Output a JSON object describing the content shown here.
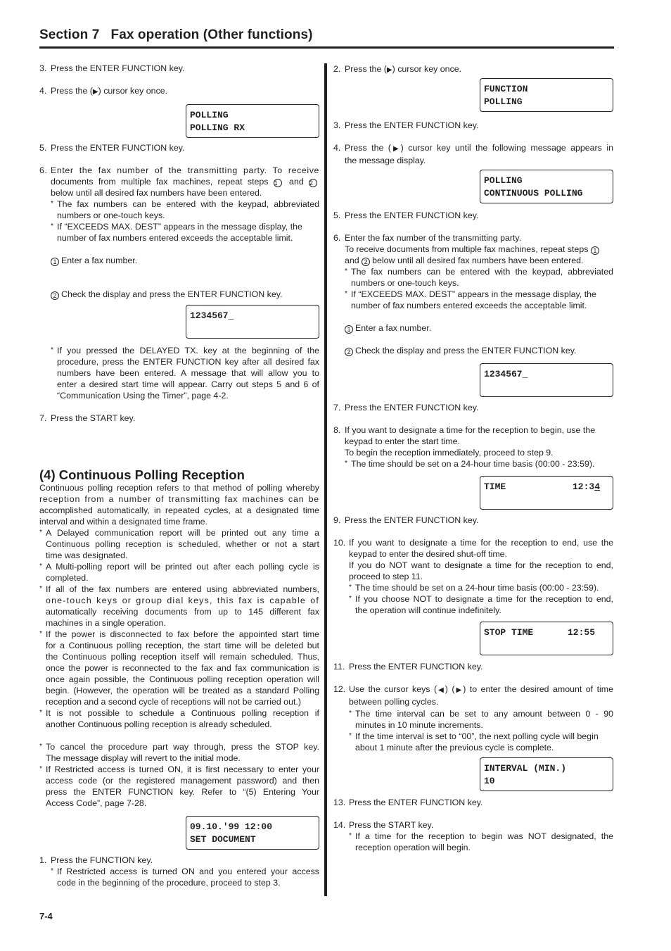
{
  "header": {
    "section": "Section 7",
    "title": "Fax operation (Other functions)"
  },
  "left": {
    "step3": {
      "num": "3.",
      "text": "Press the ENTER FUNCTION key."
    },
    "step4": {
      "num": "4.",
      "pre": "Press the (",
      "arrow": "▶",
      "post": ") cursor key once."
    },
    "lcd1": {
      "line1": "POLLING",
      "line2": "POLLING RX"
    },
    "step5": {
      "num": "5.",
      "text": "Press the ENTER FUNCTION key."
    },
    "step6": {
      "num": "6.",
      "lines": [
        "Enter the fax number of the transmitting party. To receive",
        "documents from multiple fax machines, repeat steps ① and ②",
        "below until all desired fax numbers have been entered."
      ],
      "note1": [
        "The fax numbers can be entered with the keypad, abbreviated",
        "numbers or one-touch keys."
      ],
      "note2": [
        "If “EXCEEDS MAX. DEST” appears in the message display, the",
        "number of fax numbers entered exceeds the acceptable limit."
      ],
      "sub1": {
        "marker": "1",
        "text": "Enter a fax number."
      },
      "sub2": {
        "marker": "2",
        "text": "Check the display and press the ENTER FUNCTION key."
      }
    },
    "lcd2": {
      "line1": "1234567_",
      "line2": ""
    },
    "delayed_note": [
      "If you pressed the DELAYED TX. key at the beginning of the",
      "procedure, press the ENTER FUNCTION key after all desired fax",
      "numbers have been entered. A message that will allow you to",
      "enter a desired start time will appear. Carry out steps 5 and 6 of",
      "“Communication Using the Timer”, page 4-2."
    ],
    "step7": {
      "num": "7.",
      "text": "Press the START key."
    },
    "section_heading": "(4) Continuous Polling Reception",
    "intro": [
      "Continuous polling reception refers to that method of polling whereby",
      "reception from a number of transmitting fax machines can be",
      "accomplished automatically, in repeated cycles, at a designated time",
      "interval and within a designated time frame."
    ],
    "notes": [
      [
        "A Delayed communication report will be printed out any time a",
        "Continuous polling reception is scheduled, whether or not a start",
        "time was designated."
      ],
      [
        "A Multi-polling report will be printed out after each polling cycle is",
        "completed."
      ],
      [
        "If all of the fax numbers are entered using abbreviated numbers,",
        "one-touch keys or group dial keys, this fax is capable of",
        "automatically receiving documents from up to 145 different fax",
        "machines in a single operation."
      ],
      [
        "If the power is disconnected to fax before the appointed start time",
        "for a Continuous polling reception, the start time will be deleted but",
        "the Continuous polling reception itself will remain scheduled. Thus,",
        "once the power is reconnected to the fax and fax communication is",
        "once again possible, the Continuous polling reception operation will",
        "begin. (However, the operation will be treated as a standard Polling",
        "reception and a second cycle of receptions will not be carried out.)"
      ],
      [
        "It is not possible to schedule a Continuous polling reception if",
        "another Continuous polling reception is already scheduled."
      ]
    ],
    "notes2": [
      [
        "To cancel the procedure part way through, press the STOP key.",
        "The message display will revert to the initial mode."
      ],
      [
        "If Restricted access is turned ON, it is first necessary to enter your",
        "access code (or the registered management password) and then",
        "press the ENTER FUNCTION key. Refer to “(5) Entering Your",
        "Access Code”, page 7-28."
      ]
    ],
    "lcd3": {
      "line1": "09.10.'99 12:00",
      "line2": "SET DOCUMENT"
    },
    "step1": {
      "num": "1.",
      "text": "Press the FUNCTION key.",
      "note": [
        "If Restricted access is turned ON and you entered your access",
        "code in the beginning of the procedure, proceed to step 3."
      ]
    }
  },
  "right": {
    "step2": {
      "num": "2.",
      "pre": "Press the (",
      "arrow": "▶",
      "post": ") cursor key once."
    },
    "lcd1": {
      "line1": "FUNCTION",
      "line2": "POLLING"
    },
    "step3": {
      "num": "3.",
      "text": "Press the ENTER FUNCTION key."
    },
    "step4": {
      "num": "4.",
      "line1_pre": "Press the (",
      "arrow": "▶",
      "line1_post": ") cursor key until the following message appears in",
      "line2": "the message display."
    },
    "lcd2": {
      "line1": "POLLING",
      "line2": "CONTINUOUS POLLING"
    },
    "step5": {
      "num": "5.",
      "text": "Press the ENTER FUNCTION key."
    },
    "step6": {
      "num": "6.",
      "lines": [
        "Enter the fax number of the transmitting party.",
        "To receive documents from multiple fax machines, repeat steps ①",
        "and ② below until all desired fax numbers have been entered."
      ],
      "note1": [
        "The fax numbers can be entered with the keypad, abbreviated",
        "numbers or one-touch keys."
      ],
      "note2": [
        "If “EXCEEDS MAX. DEST” appears in the message display, the",
        "number of fax numbers entered exceeds the acceptable limit."
      ],
      "sub1": {
        "marker": "1",
        "text": "Enter a fax number."
      },
      "sub2": {
        "marker": "2",
        "text": "Check the display and press the ENTER FUNCTION key."
      }
    },
    "lcd3": {
      "line1": "1234567_",
      "line2": ""
    },
    "step7": {
      "num": "7.",
      "text": "Press the ENTER FUNCTION key."
    },
    "step8": {
      "num": "8.",
      "lines": [
        "If you want to designate a time for the reception to begin, use the",
        "keypad to enter the start time.",
        "To begin the reception immediately, proceed to step 9."
      ],
      "note": "The time should be set on a 24-hour time basis (00:00 - 23:59)."
    },
    "lcd4": {
      "label": "TIME",
      "value_main": "12:3",
      "value_cursor": "4"
    },
    "step9": {
      "num": "9.",
      "text": "Press the ENTER FUNCTION key."
    },
    "step10": {
      "num": "10.",
      "lines": [
        "If you want to designate a time for the reception to end, use the",
        "keypad to enter the desired shut-off time.",
        "If you do NOT want to designate a time for the reception to end,",
        "proceed to step 11."
      ],
      "note1": "The time should be set on a 24-hour time basis (00:00 - 23:59).",
      "note2": [
        "If you choose NOT to designate a time for the reception to end,",
        "the operation will continue indefinitely."
      ]
    },
    "lcd5": {
      "label": "STOP TIME",
      "value": "12:55"
    },
    "step11": {
      "num": "11.",
      "text": "Press the ENTER FUNCTION key."
    },
    "step12": {
      "num": "12.",
      "pre": "Use the cursor keys (",
      "arrow_left": "◀",
      "mid": ") (",
      "arrow_right": "▶",
      "post": ") to enter the desired amount of time",
      "line2": "between polling cycles.",
      "note1": [
        "The time interval can be set to any amount between 0 - 90",
        "minutes in 10 minute increments."
      ],
      "note2": [
        "If the time interval is set to “00”, the next polling cycle will begin",
        "about 1 minute after the previous cycle is complete."
      ]
    },
    "lcd6": {
      "line1": "INTERVAL (MIN.)",
      "line2": "10"
    },
    "step13": {
      "num": "13.",
      "text": "Press the ENTER FUNCTION key."
    },
    "step14": {
      "num": "14.",
      "text": "Press the START key.",
      "note": [
        "If a time for the reception to begin was NOT designated, the",
        "reception operation will begin."
      ]
    }
  },
  "footer": {
    "page_number": "7-4"
  }
}
